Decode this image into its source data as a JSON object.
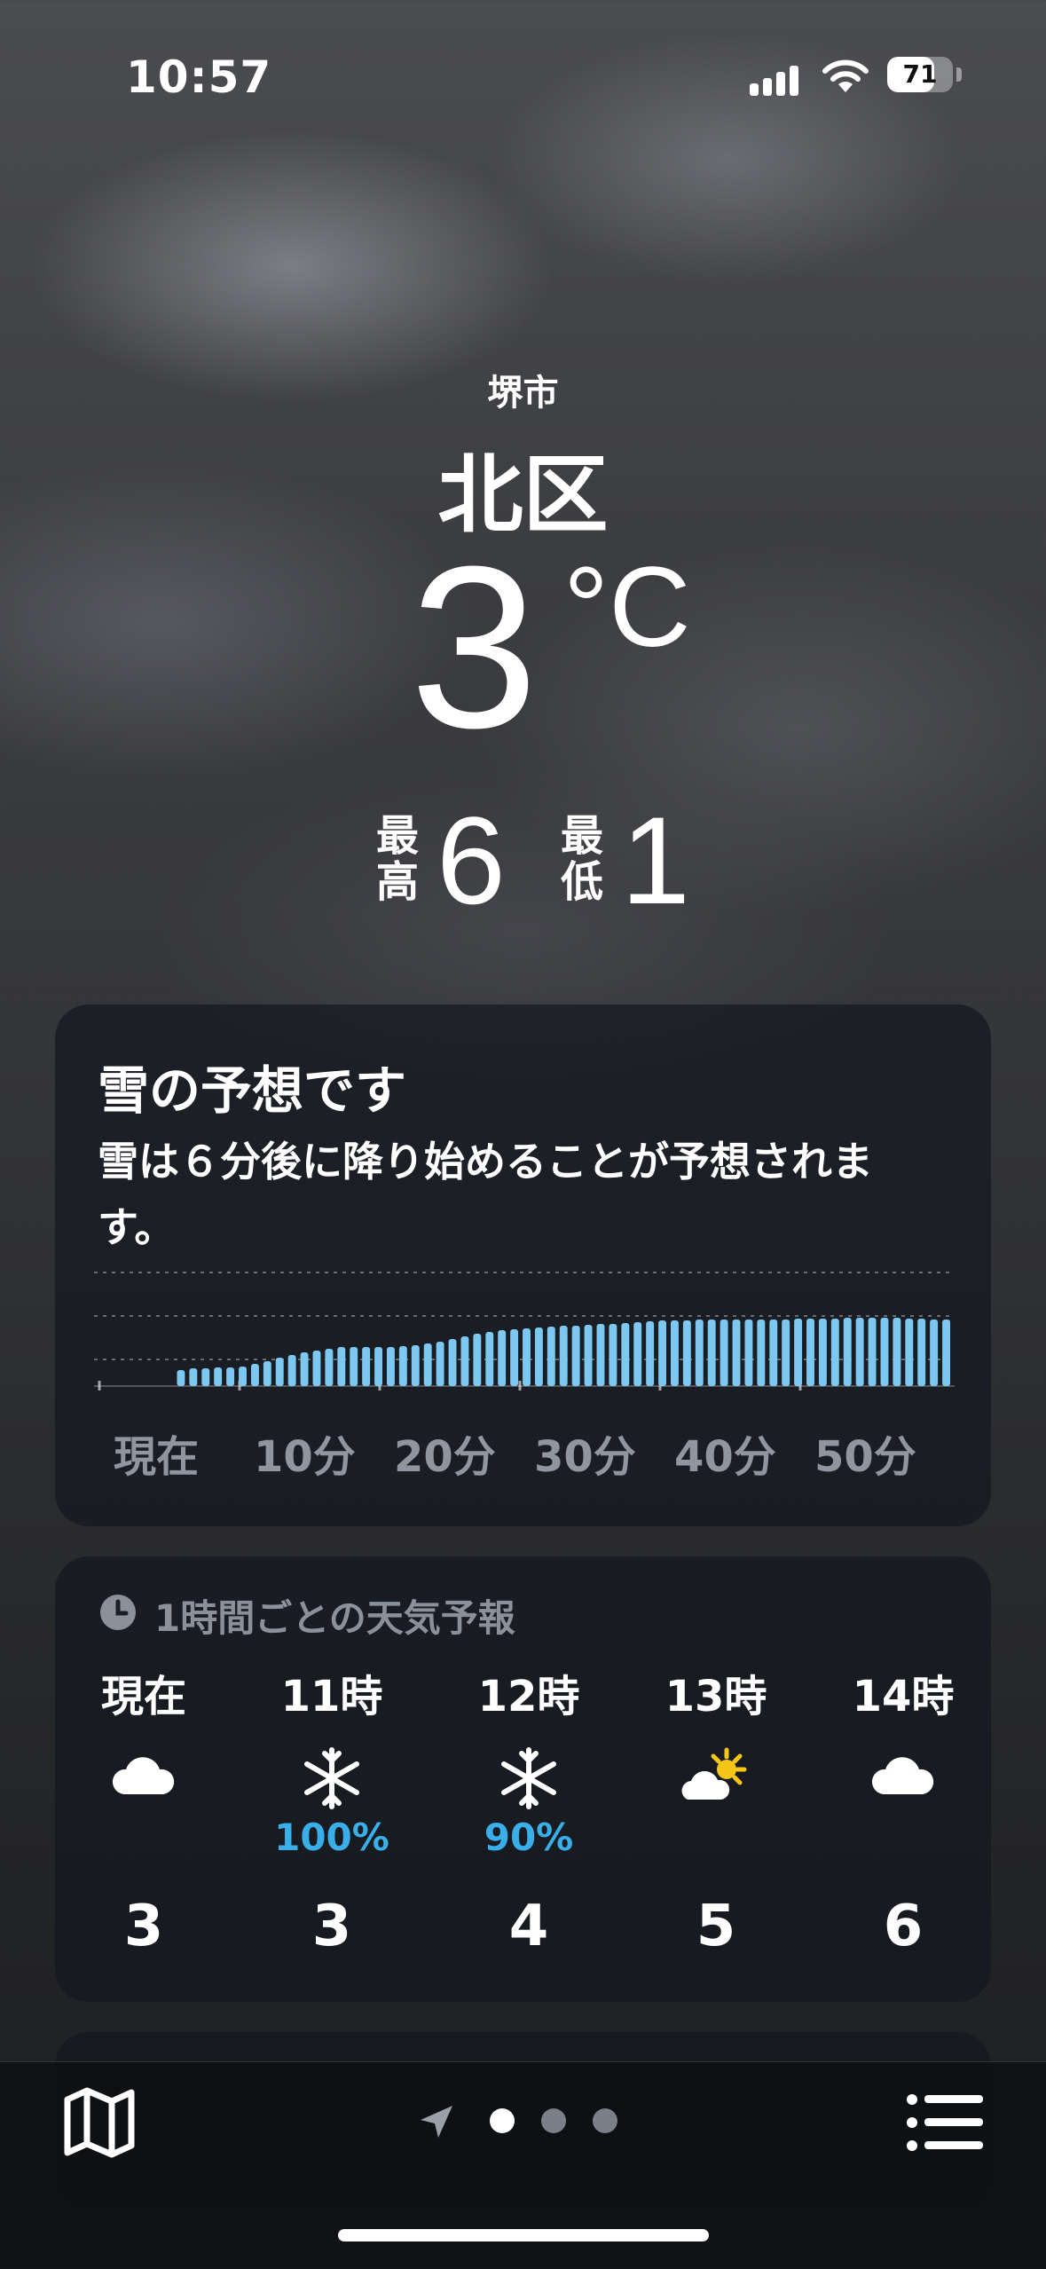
{
  "status": {
    "time": "10:57",
    "battery": "71",
    "battery_level": 0.71
  },
  "location": {
    "city": "堺市",
    "district": "北区"
  },
  "current": {
    "temp": "3",
    "unit": "°C"
  },
  "hilo": {
    "high_label_1": "最",
    "high_label_2": "高",
    "high": "6",
    "low_label_1": "最",
    "low_label_2": "低",
    "low": "1"
  },
  "precip_card": {
    "title": "雪の予想です",
    "description": "雪は６分後に降り始めることが予想されます。",
    "x_labels": [
      "現在",
      "10分",
      "20分",
      "30分",
      "40分",
      "50分"
    ]
  },
  "chart_data": {
    "type": "bar",
    "xlabel": "",
    "ylabel": "",
    "x_tick_labels": [
      "現在",
      "10分",
      "20分",
      "30分",
      "40分",
      "50分"
    ],
    "levels_note_scale": [
      0,
      1
    ],
    "values": [
      0,
      0,
      0,
      0,
      0,
      0,
      0.18,
      0.2,
      0.2,
      0.21,
      0.21,
      0.22,
      0.25,
      0.28,
      0.32,
      0.35,
      0.38,
      0.4,
      0.42,
      0.44,
      0.44,
      0.44,
      0.44,
      0.44,
      0.45,
      0.46,
      0.48,
      0.5,
      0.53,
      0.56,
      0.59,
      0.61,
      0.63,
      0.64,
      0.65,
      0.66,
      0.67,
      0.68,
      0.68,
      0.69,
      0.7,
      0.7,
      0.71,
      0.72,
      0.73,
      0.74,
      0.74,
      0.74,
      0.75,
      0.75,
      0.75,
      0.75,
      0.75,
      0.75,
      0.75,
      0.75,
      0.76,
      0.76,
      0.76,
      0.76,
      0.77,
      0.77,
      0.77,
      0.77,
      0.77,
      0.76,
      0.76,
      0.75,
      0.75
    ],
    "grid": true,
    "color": "#7cc8f0"
  },
  "hourly": {
    "header": "1時間ごとの天気予報",
    "items": [
      {
        "hour": "現在",
        "icon": "cloud-icon",
        "pop": "",
        "temp": "3"
      },
      {
        "hour": "11時",
        "icon": "snowflake-icon",
        "pop": "100%",
        "temp": "3"
      },
      {
        "hour": "12時",
        "icon": "snowflake-icon",
        "pop": "90%",
        "temp": "4"
      },
      {
        "hour": "13時",
        "icon": "partly-sunny-icon",
        "pop": "",
        "temp": "5"
      },
      {
        "hour": "14時",
        "icon": "cloud-icon",
        "pop": "",
        "temp": "6"
      }
    ]
  },
  "colors": {
    "precip_blue": "#3aaee8",
    "sun_yellow": "#f5c518"
  }
}
